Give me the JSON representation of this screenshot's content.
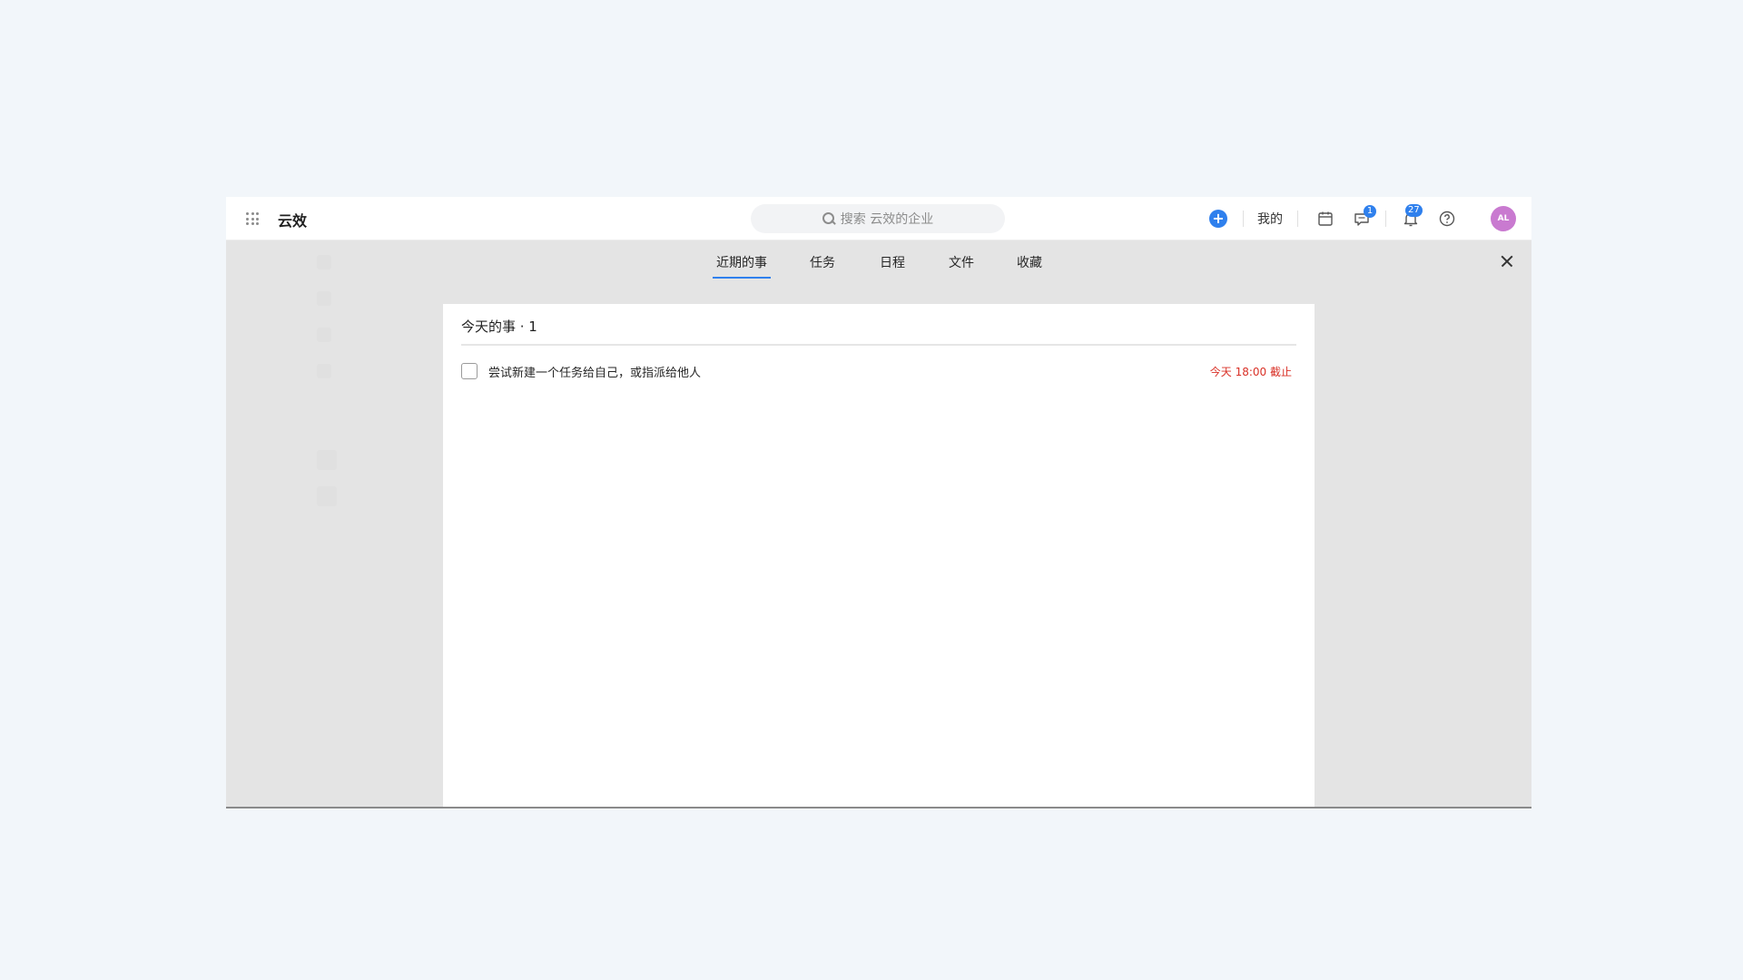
{
  "header": {
    "app_title": "云效",
    "search_placeholder": "搜索 云效的企业",
    "mine_label": "我的",
    "message_badge": "1",
    "notification_badge": "27",
    "avatar_initials": "AL"
  },
  "tabs": [
    {
      "label": "近期的事",
      "active": true
    },
    {
      "label": "任务",
      "active": false
    },
    {
      "label": "日程",
      "active": false
    },
    {
      "label": "文件",
      "active": false
    },
    {
      "label": "收藏",
      "active": false
    }
  ],
  "panel": {
    "section_title": "今天的事 · 1",
    "tasks": [
      {
        "title": "尝试新建一个任务给自己，或指派给他人",
        "due": "今天 18:00 截止",
        "done": false
      }
    ]
  },
  "colors": {
    "accent": "#2f80ed",
    "due_red": "#d93026",
    "avatar": "#c97ad0"
  },
  "icons": [
    "apps-grid-icon",
    "search-icon",
    "plus-icon",
    "calendar-icon",
    "message-icon",
    "bell-icon",
    "help-icon",
    "close-icon"
  ]
}
